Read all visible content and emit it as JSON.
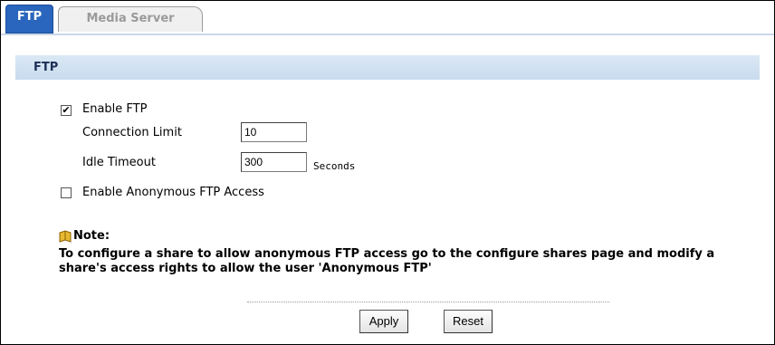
{
  "tabs": [
    {
      "label": "FTP",
      "active": true
    },
    {
      "label": "Media Server",
      "active": false
    }
  ],
  "section": {
    "title": "FTP"
  },
  "enable_ftp": {
    "label": "Enable FTP",
    "checked": true
  },
  "connection_limit": {
    "label": "Connection Limit",
    "value": "10"
  },
  "idle_timeout": {
    "label": "Idle Timeout",
    "value": "300",
    "unit": "Seconds"
  },
  "anonymous": {
    "label": "Enable Anonymous FTP Access",
    "checked": false
  },
  "note": {
    "title": "Note:",
    "text": "To configure a share to allow anonymous FTP access go to the configure shares page and modify a share's access rights to allow the user 'Anonymous FTP'"
  },
  "buttons": {
    "apply": "Apply",
    "reset": "Reset"
  },
  "colors": {
    "tab_active_bg": "#2a66bd",
    "section_header_bg": "#c8dbee",
    "note_icon": "#d9a520"
  },
  "icons": {
    "note": "note-book-icon",
    "checkmark": "checkmark-icon"
  }
}
